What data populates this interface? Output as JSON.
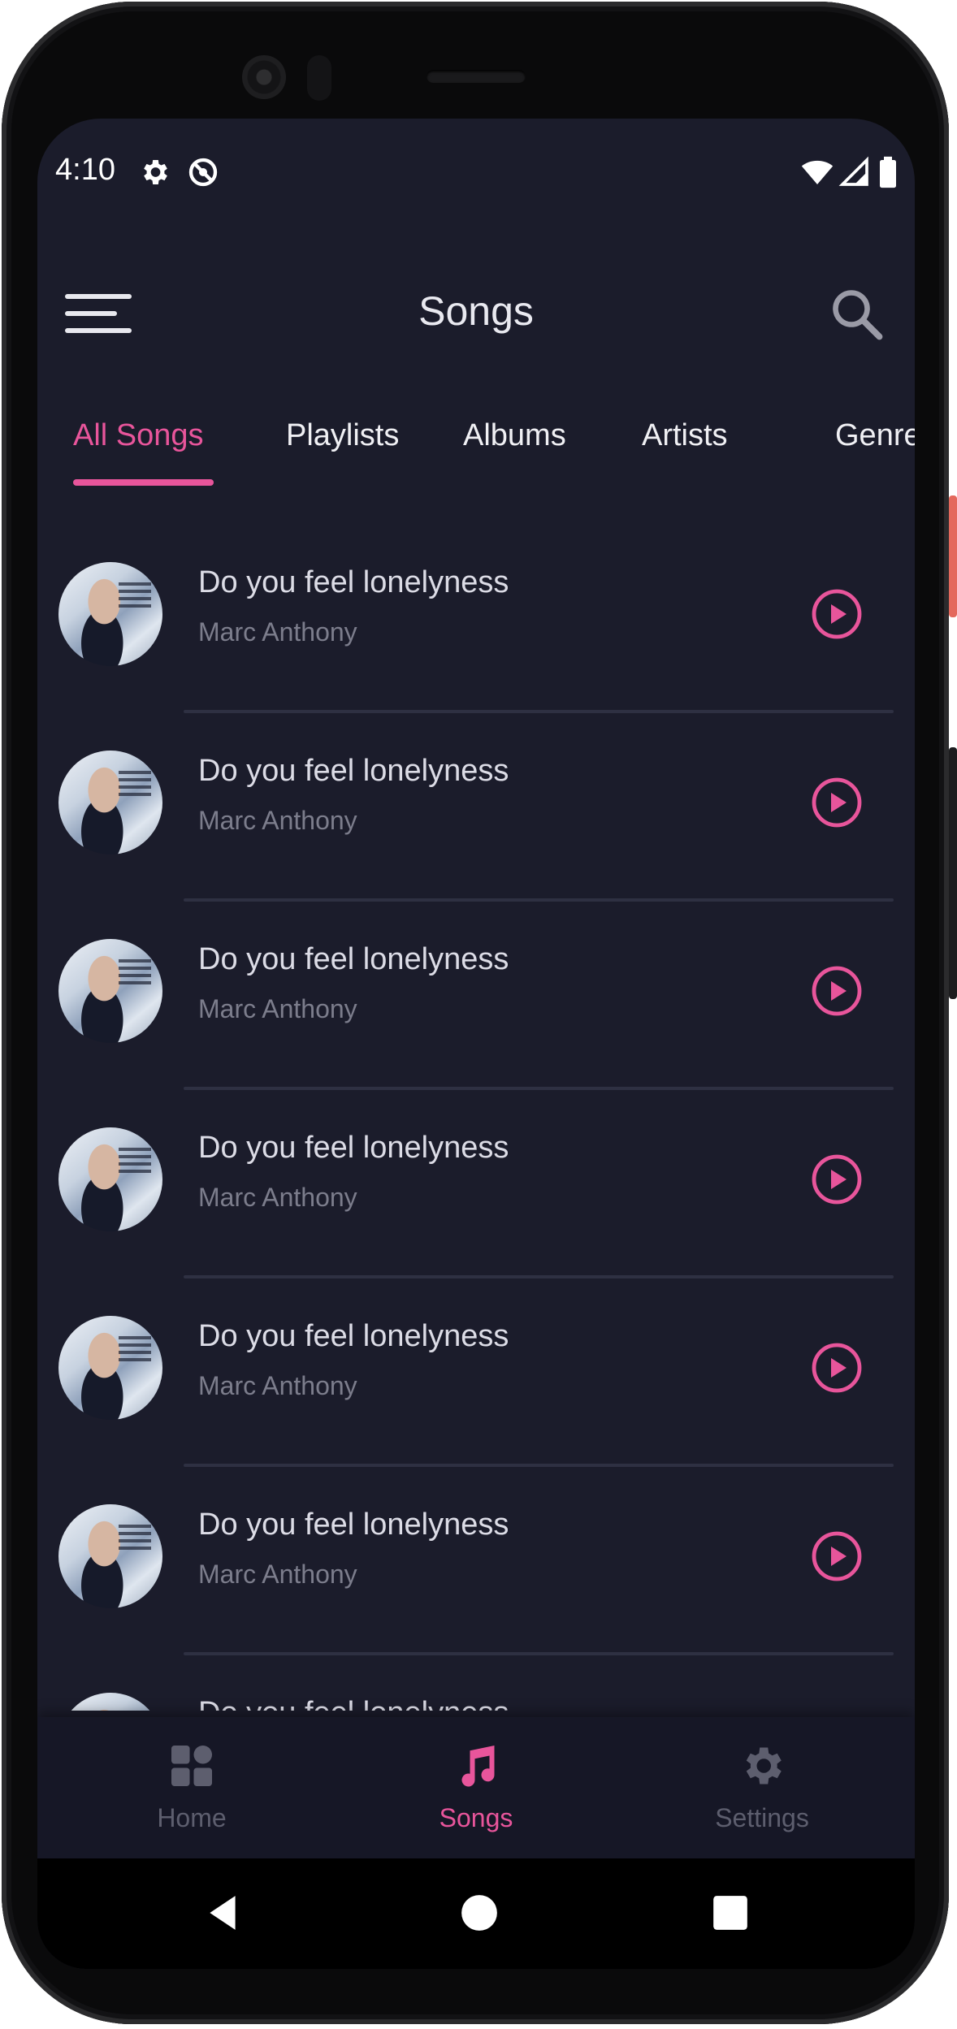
{
  "status_bar": {
    "time": "4:10",
    "icons": [
      "gear-icon",
      "do-not-disturb-icon",
      "wifi-icon",
      "signal-icon",
      "battery-icon"
    ]
  },
  "header": {
    "title": "Songs",
    "menu_icon": "hamburger-menu-icon",
    "search_icon": "search-icon"
  },
  "tabs": [
    {
      "label": "All Songs",
      "active": true
    },
    {
      "label": "Playlists",
      "active": false
    },
    {
      "label": "Albums",
      "active": false
    },
    {
      "label": "Artists",
      "active": false
    },
    {
      "label": "Genre",
      "active": false
    }
  ],
  "songs": [
    {
      "title": "Do you feel lonelyness",
      "artist": "Marc Anthony"
    },
    {
      "title": "Do you feel lonelyness",
      "artist": "Marc Anthony"
    },
    {
      "title": "Do you feel lonelyness",
      "artist": "Marc Anthony"
    },
    {
      "title": "Do you feel lonelyness",
      "artist": "Marc Anthony"
    },
    {
      "title": "Do you feel lonelyness",
      "artist": "Marc Anthony"
    },
    {
      "title": "Do you feel lonelyness",
      "artist": "Marc Anthony"
    },
    {
      "title": "Do you feel lonelyness",
      "artist": ""
    }
  ],
  "bottom_nav": [
    {
      "label": "Home",
      "icon": "grid-icon",
      "active": false
    },
    {
      "label": "Songs",
      "icon": "music-note-icon",
      "active": true
    },
    {
      "label": "Settings",
      "icon": "gear-icon",
      "active": false
    }
  ],
  "system_nav": [
    "back-icon",
    "home-icon",
    "recents-icon"
  ],
  "colors": {
    "background": "#1b1c2b",
    "accent": "#e8559b",
    "text_primary": "#dcdce6",
    "text_secondary": "#7c7d8c"
  }
}
